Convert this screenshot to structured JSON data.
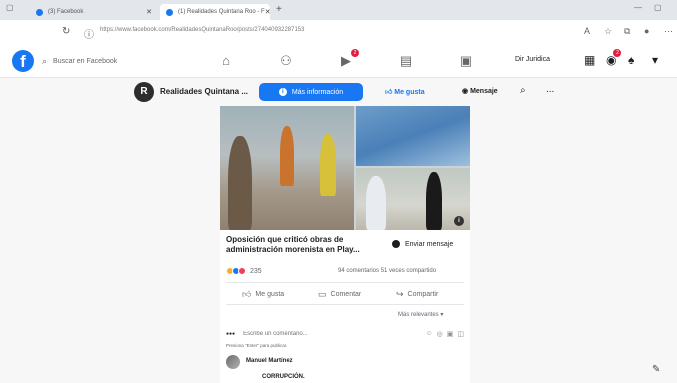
{
  "browser": {
    "tabs": [
      {
        "label": "(3) Facebook"
      },
      {
        "label": "(1) Realidades Quintana Roo - F"
      }
    ],
    "new_tab": "+",
    "url": "https://www.facebook.com/RealidadesQuintanaRoo/posts/274040932287153"
  },
  "fb_header": {
    "logo": "f",
    "search_placeholder": "Buscar en Facebook",
    "notifications_badge": "2",
    "messenger_badge": "2",
    "user_name": "Dir Juridica"
  },
  "page_header": {
    "page_initial": "R",
    "page_name": "Realidades Quintana ...",
    "more_info_label": "Más información",
    "like_label": "Me gusta",
    "message_label": "Mensaje",
    "more_label": "..."
  },
  "post": {
    "link_title": "Oposición que criticó obras de administración morenista en Play...",
    "send_message_label": "Enviar mensaje",
    "reaction_count": "235",
    "stats": "94 comentarios  51 veces compartido",
    "actions": {
      "like": "Me gusta",
      "comment": "Comentar",
      "share": "Compartir"
    },
    "sort_label": "Más relevantes",
    "comment_placeholder": "Escribe un comentario...",
    "enter_hint": "Presiona \"Enter\" para publicar.",
    "commenter_name": "Manuel Martínez",
    "comment_text": "CORRUPCIÓN."
  },
  "colors": {
    "brand": "#1877f2",
    "badge": "#e41e3f",
    "like_reaction": "#1877f2",
    "haha_reaction": "#f7b125",
    "love_reaction": "#f33e58"
  }
}
